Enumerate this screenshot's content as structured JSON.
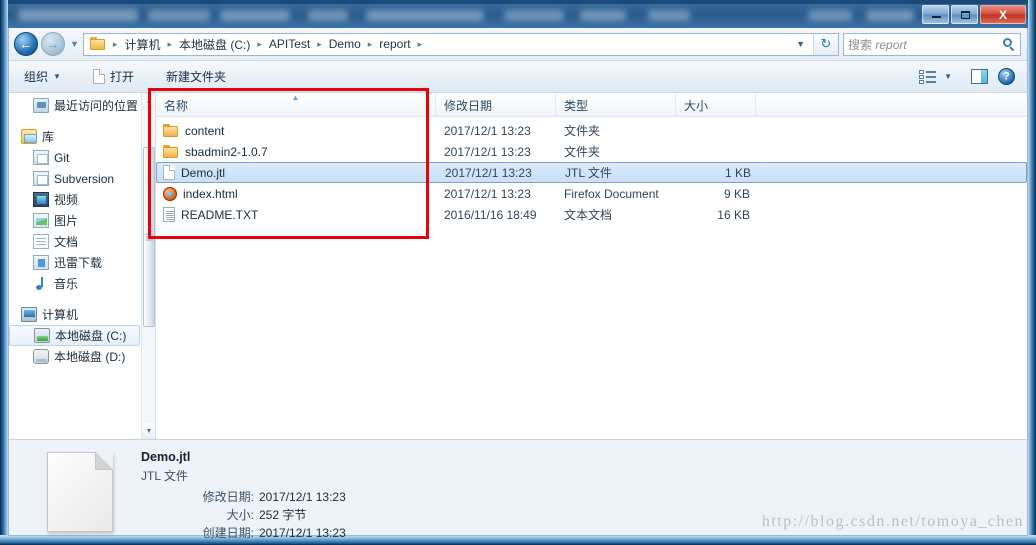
{
  "window": {
    "buttons": {
      "minimize": "minimize-button",
      "maximize": "maximize-button",
      "close_label": "X"
    }
  },
  "navbar": {
    "back_arrow": "←",
    "forward_arrow": "→",
    "history_caret": "▼",
    "breadcrumb": [
      "计算机",
      "本地磁盘 (C:)",
      "APITest",
      "Demo",
      "report"
    ],
    "separator": "▸",
    "dropdown_caret": "▼",
    "refresh_glyph": "↻",
    "search": {
      "placeholder_cn": "搜索 ",
      "placeholder_term": "report"
    }
  },
  "toolbar": {
    "organize_label": "组织",
    "organize_caret": "▼",
    "open_label": "打开",
    "new_folder_label": "新建文件夹",
    "view_caret": "▼",
    "help_label": "?"
  },
  "sidebar": {
    "items": [
      {
        "label": "最近访问的位置",
        "icon": "recent-places-icon",
        "level": "child",
        "selected": false
      },
      {
        "label": "库",
        "icon": "library-icon",
        "level": "root",
        "selected": false
      },
      {
        "label": "Git",
        "icon": "git-library-icon",
        "level": "child",
        "selected": false
      },
      {
        "label": "Subversion",
        "icon": "subversion-library-icon",
        "level": "child",
        "selected": false
      },
      {
        "label": "视频",
        "icon": "videos-icon",
        "level": "child",
        "selected": false
      },
      {
        "label": "图片",
        "icon": "pictures-icon",
        "level": "child",
        "selected": false
      },
      {
        "label": "文档",
        "icon": "documents-icon",
        "level": "child",
        "selected": false
      },
      {
        "label": "迅雷下载",
        "icon": "thunder-download-icon",
        "level": "child",
        "selected": false
      },
      {
        "label": "音乐",
        "icon": "music-icon",
        "level": "child",
        "selected": false
      },
      {
        "label": "计算机",
        "icon": "computer-icon",
        "level": "root",
        "selected": false
      },
      {
        "label": "本地磁盘 (C:)",
        "icon": "local-disk-c-icon",
        "level": "child",
        "selected": true
      },
      {
        "label": "本地磁盘 (D:)",
        "icon": "local-disk-d-icon",
        "level": "child",
        "selected": false
      }
    ],
    "scroll_up": "▲",
    "scroll_down": "▼"
  },
  "filelist": {
    "columns": [
      {
        "key": "name",
        "label": "名称",
        "sorted": true,
        "sort_arrow": "▲"
      },
      {
        "key": "date",
        "label": "修改日期",
        "sorted": false
      },
      {
        "key": "type",
        "label": "类型",
        "sorted": false
      },
      {
        "key": "size",
        "label": "大小",
        "sorted": false
      }
    ],
    "rows": [
      {
        "name": "content",
        "date": "2017/12/1 13:23",
        "type": "文件夹",
        "size": "",
        "icon": "folder-icon",
        "selected": false
      },
      {
        "name": "sbadmin2-1.0.7",
        "date": "2017/12/1 13:23",
        "type": "文件夹",
        "size": "",
        "icon": "folder-icon",
        "selected": false
      },
      {
        "name": "Demo.jtl",
        "date": "2017/12/1 13:23",
        "type": "JTL 文件",
        "size": "1 KB",
        "icon": "generic-file-icon",
        "selected": true
      },
      {
        "name": "index.html",
        "date": "2017/12/1 13:23",
        "type": "Firefox Document",
        "size": "9 KB",
        "icon": "firefox-icon",
        "selected": false
      },
      {
        "name": "README.TXT",
        "date": "2016/11/16 18:49",
        "type": "文本文档",
        "size": "16 KB",
        "icon": "text-file-icon",
        "selected": false
      }
    ]
  },
  "details": {
    "file_name": "Demo.jtl",
    "file_type": "JTL 文件",
    "fields": [
      {
        "label": "修改日期:",
        "value": "2017/12/1 13:23"
      },
      {
        "label": "大小:",
        "value": "252 字节"
      },
      {
        "label": "创建日期:",
        "value": "2017/12/1 13:23"
      }
    ]
  },
  "annotation": {
    "color": "#e8000a"
  },
  "watermark": {
    "text": "http://blog.csdn.net/tomoya_chen"
  }
}
